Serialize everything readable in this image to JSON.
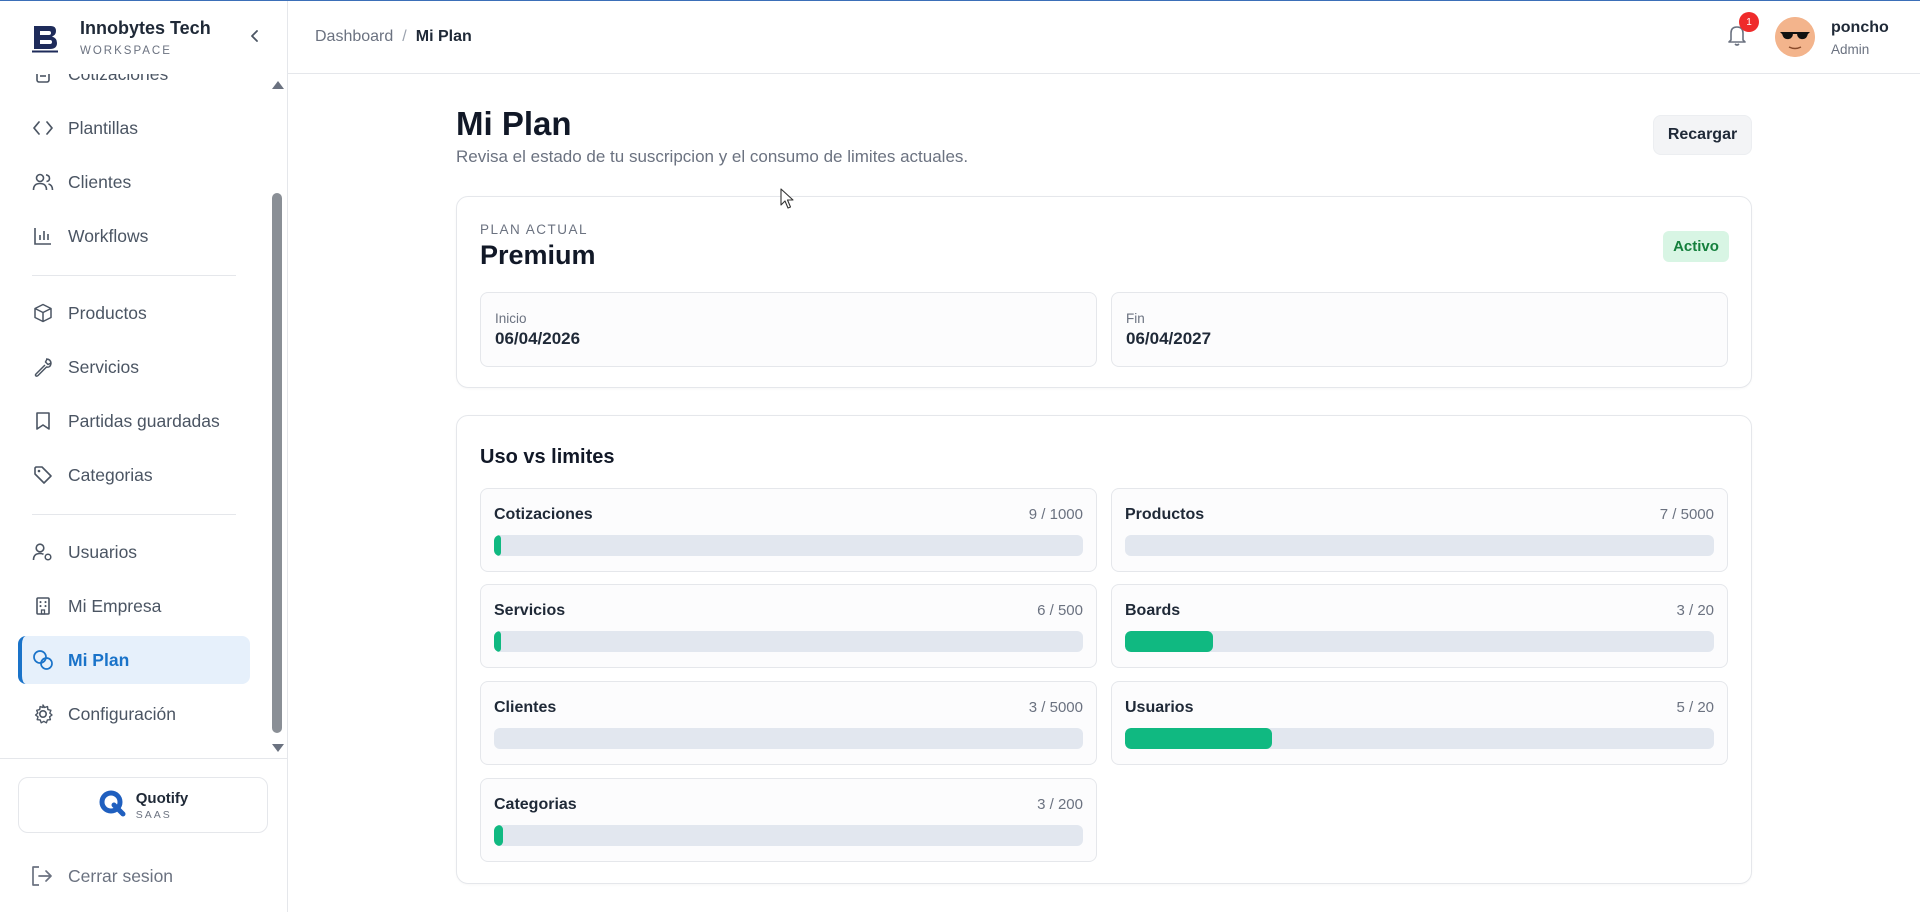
{
  "brand": {
    "name": "Innobytes Tech",
    "subtitle": "WORKSPACE"
  },
  "sidebar": {
    "partial_item": "Cotizaciones",
    "items": [
      {
        "label": "Plantillas",
        "icon": "code-icon"
      },
      {
        "label": "Clientes",
        "icon": "users-icon"
      },
      {
        "label": "Workflows",
        "icon": "bar-chart-icon"
      },
      {
        "label": "Productos",
        "icon": "box-icon"
      },
      {
        "label": "Servicios",
        "icon": "wrench-icon"
      },
      {
        "label": "Partidas guardadas",
        "icon": "bookmark-icon"
      },
      {
        "label": "Categorias",
        "icon": "tag-icon"
      },
      {
        "label": "Usuarios",
        "icon": "user-gear-icon"
      },
      {
        "label": "Mi Empresa",
        "icon": "building-icon"
      },
      {
        "label": "Mi Plan",
        "icon": "plan-icon",
        "active": true
      },
      {
        "label": "Configuración",
        "icon": "gear-icon"
      }
    ],
    "app_card": {
      "name": "Quotify",
      "subtitle": "SAAS"
    },
    "logout_label": "Cerrar sesion"
  },
  "topbar": {
    "breadcrumb": {
      "root": "Dashboard",
      "separator": "/",
      "current": "Mi Plan"
    },
    "notification_count": "1",
    "user": {
      "name": "poncho",
      "role": "Admin"
    }
  },
  "page": {
    "title": "Mi Plan",
    "subtitle": "Revisa el estado de tu suscripcion y el consumo de limites actuales.",
    "reload_label": "Recargar"
  },
  "plan": {
    "label": "PLAN ACTUAL",
    "name": "Premium",
    "status": "Activo",
    "start_label": "Inicio",
    "start_date": "06/04/2026",
    "end_label": "Fin",
    "end_date": "06/04/2027"
  },
  "usage": {
    "title": "Uso vs limites",
    "items": [
      {
        "label": "Cotizaciones",
        "count": "9 / 1000",
        "fraction": 0.009
      },
      {
        "label": "Productos",
        "count": "7 / 5000",
        "fraction": 0.0014
      },
      {
        "label": "Servicios",
        "count": "6 / 500",
        "fraction": 0.012
      },
      {
        "label": "Boards",
        "count": "3 / 20",
        "fraction": 0.15
      },
      {
        "label": "Clientes",
        "count": "3 / 5000",
        "fraction": 0.0006
      },
      {
        "label": "Usuarios",
        "count": "5 / 20",
        "fraction": 0.25
      },
      {
        "label": "Categorias",
        "count": "3 / 200",
        "fraction": 0.015
      }
    ]
  },
  "colors": {
    "accent": "#1a73c9",
    "progress": "#10b981",
    "badge_bg": "#d8f5e4",
    "badge_text": "#15803d",
    "notification": "#ef2b2b"
  }
}
